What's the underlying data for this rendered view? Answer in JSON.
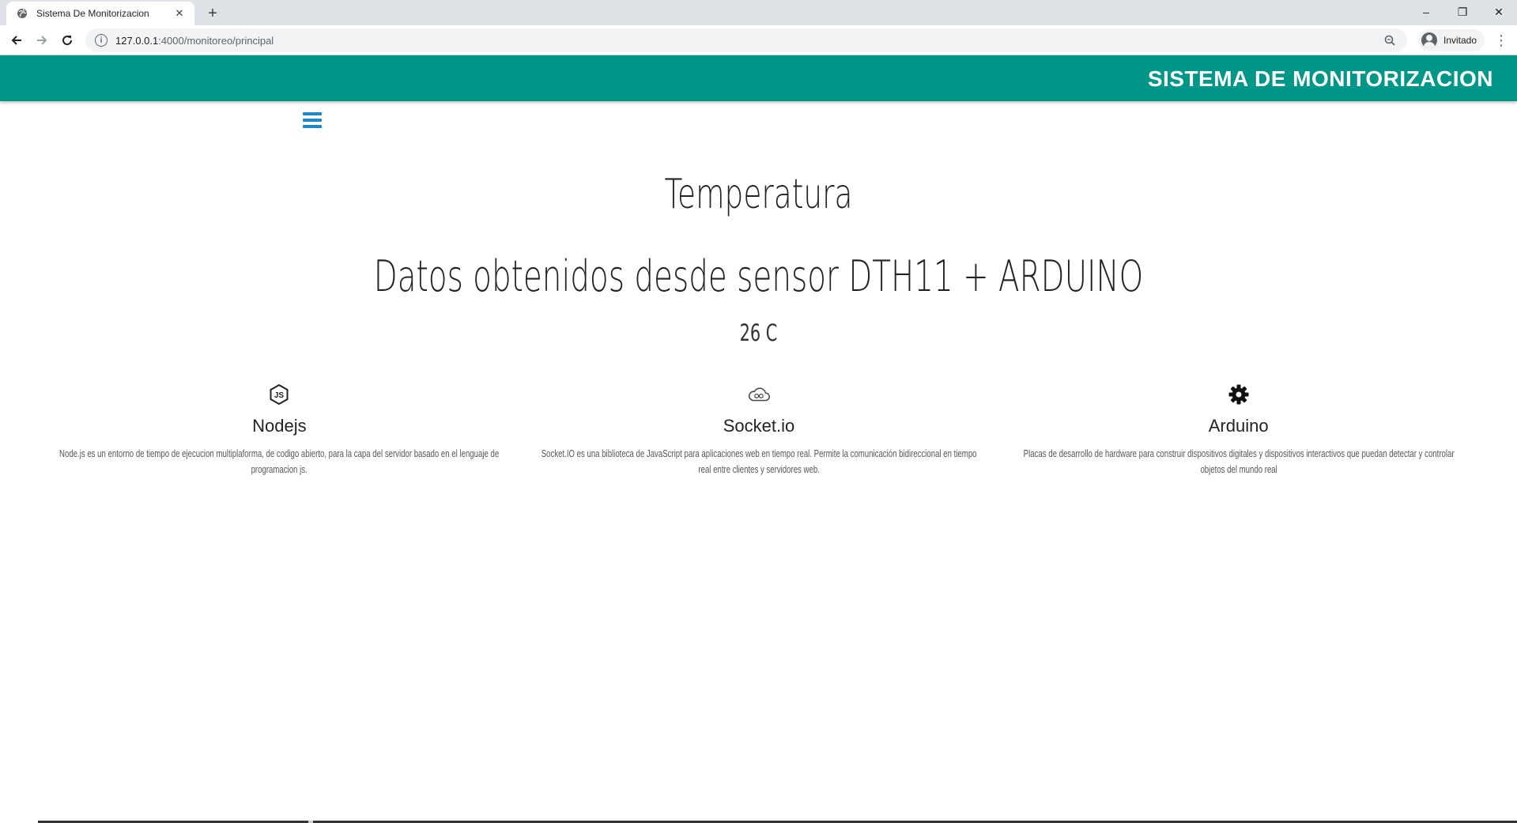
{
  "browser": {
    "tab_title": "Sistema De Monitorizacion",
    "tab_close": "✕",
    "new_tab": "+",
    "url_host": "127.0.0.1",
    "url_path": ":4000/monitoreo/principal",
    "profile_label": "Invitado",
    "window_controls": {
      "minimize": "–",
      "restore": "❐",
      "close": "✕"
    }
  },
  "header": {
    "title": "SISTEMA DE MONITORIZACION",
    "bg_color": "#009688"
  },
  "main": {
    "heading": "Temperatura",
    "subheading": "Datos obtenidos desde sensor DTH11 + ARDUINO",
    "reading": "26 C"
  },
  "features": [
    {
      "icon": "nodejs-icon",
      "name": "Nodejs",
      "description": "Node.js es un entorno de tiempo de ejecucion multiplaforma, de codigo abierto, para la capa del servidor basado en el lenguaje de programacion js."
    },
    {
      "icon": "cloud-icon",
      "name": "Socket.io",
      "description": "Socket.IO es una biblioteca de JavaScript para aplicaciones web en tiempo real. Permite la comunicación bidireccional en tiempo real entre clientes y servidores web."
    },
    {
      "icon": "gear-icon",
      "name": "Arduino",
      "description": "Placas de desarrollo de hardware para construir dispositivos digitales y dispositivos interactivos que puedan detectar y controlar objetos del mundo real"
    }
  ]
}
